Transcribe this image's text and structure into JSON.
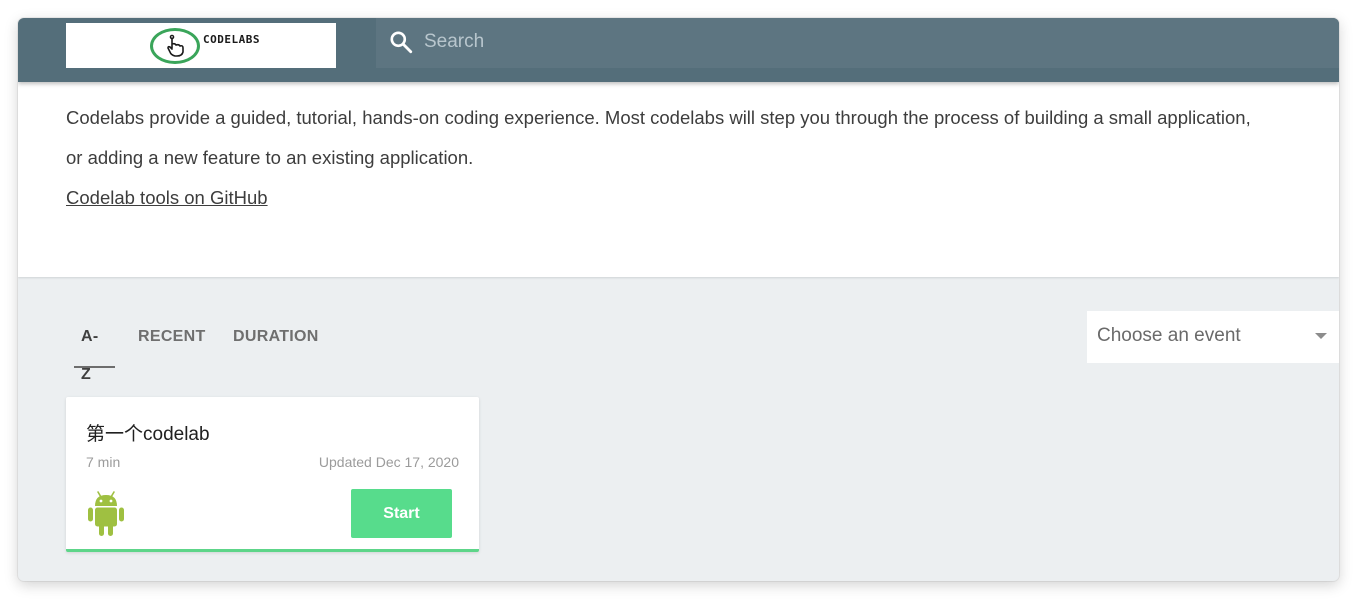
{
  "header": {
    "logo_text": "CODELABS",
    "search_placeholder": "Search"
  },
  "intro": {
    "description": "Codelabs provide a guided, tutorial, hands-on coding experience. Most codelabs will step you through the process of building a small application, or adding a new feature to an existing application.",
    "github_link": "Codelab tools on GitHub"
  },
  "tabs": [
    {
      "label": "A-Z",
      "active": true
    },
    {
      "label": "RECENT",
      "active": false
    },
    {
      "label": "DURATION",
      "active": false
    }
  ],
  "event_select": {
    "placeholder": "Choose an event"
  },
  "cards": [
    {
      "title": "第一个codelab",
      "duration": "7 min",
      "updated": "Updated Dec 17, 2020",
      "category_icon": "android-icon",
      "button": "Start"
    }
  ],
  "colors": {
    "header": "#546e7a",
    "accent": "#57dc8c",
    "android": "#9fc041",
    "logo_ring": "#3aa55a"
  }
}
